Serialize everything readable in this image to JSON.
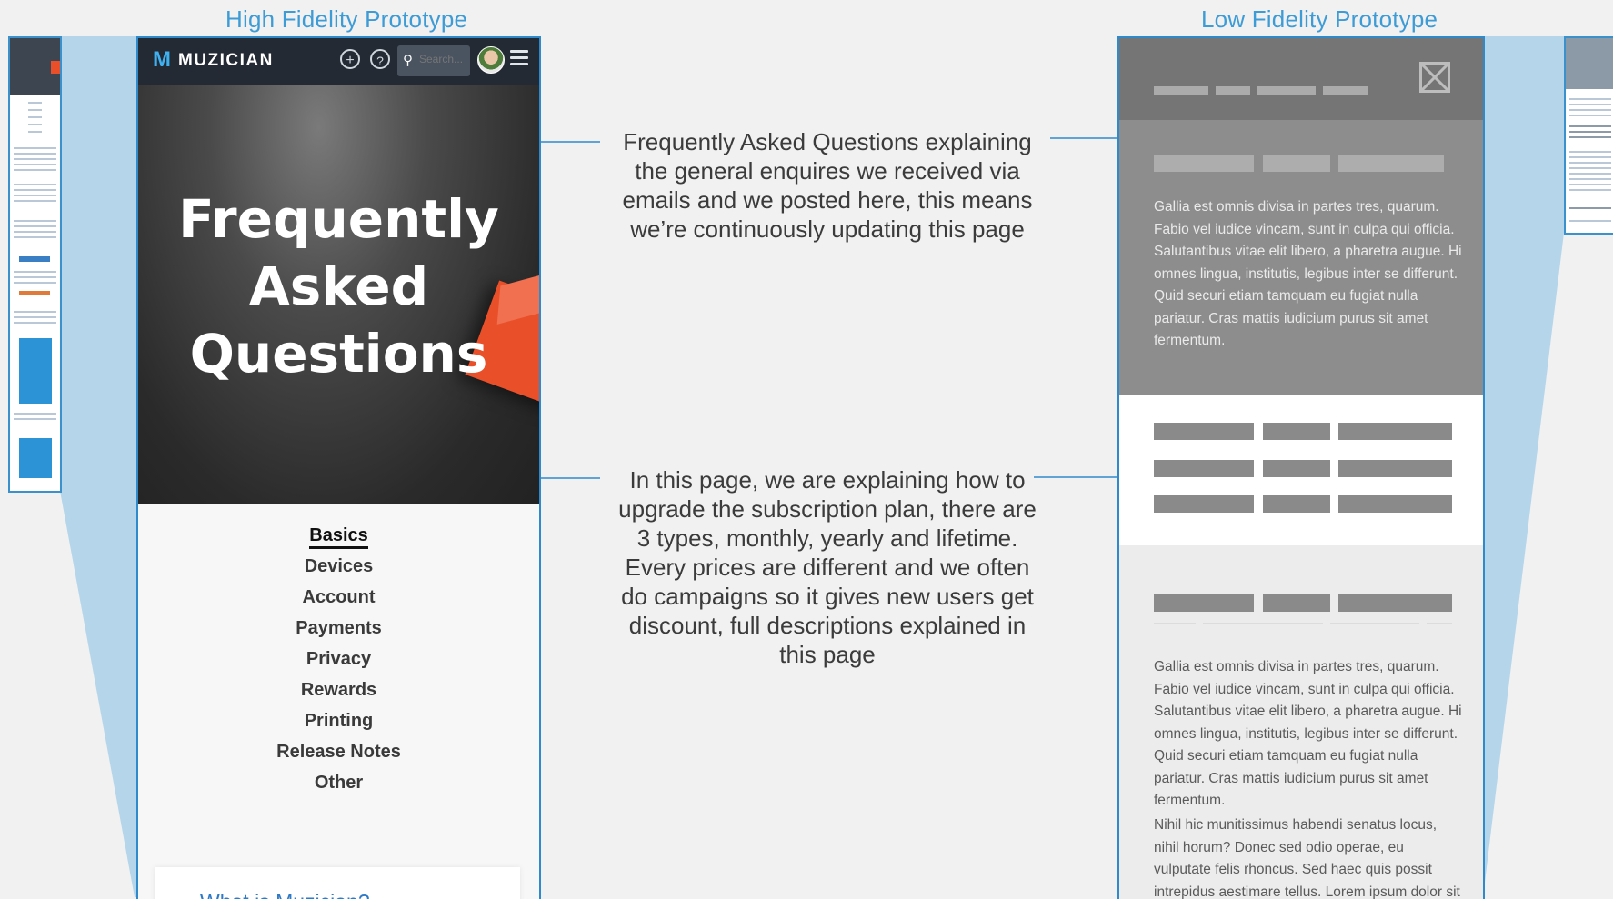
{
  "labels": {
    "high_fidelity": "High Fidelity Prototype",
    "low_fidelity": "Low Fidelity Prototype"
  },
  "navbar": {
    "logo_letter": "M",
    "logo_text": "MUZICIAN",
    "add_icon": "+",
    "help_icon": "?",
    "search_placeholder": "Search..."
  },
  "hero": {
    "title_line1": "Frequently",
    "title_line2": "Asked",
    "title_line3": "Questions"
  },
  "faq_nav": {
    "items": [
      "Basics",
      "Devices",
      "Account",
      "Payments",
      "Privacy",
      "Rewards",
      "Printing",
      "Release Notes",
      "Other"
    ],
    "active": "Basics"
  },
  "card": {
    "title": "What is Muzician?"
  },
  "annotations": {
    "first": "Frequently Asked Questions explaining the general enquires we received via emails and we posted here, this means we’re continuously updating this page",
    "second": "In this page, we are explaining how to upgrade the subscription plan, there are 3 types, monthly, yearly and lifetime. Every prices are different and we often do campaigns so it gives new users get discount, full descriptions explained in this page"
  },
  "wireframe": {
    "lorem1": "Gallia est omnis divisa in partes tres, quarum. Fabio vel iudice vincam, sunt in culpa qui officia. Salutantibus vitae elit libero, a pharetra augue. Hi omnes lingua, institutis, legibus inter se differunt. Quid securi etiam tamquam eu fugiat nulla pariatur. Cras mattis iudicium purus sit amet fermentum.",
    "lorem2": "Gallia est omnis divisa in partes tres, quarum. Fabio vel iudice vincam, sunt in culpa qui officia. Salutantibus vitae elit libero, a pharetra augue. Hi omnes lingua, institutis, legibus inter se differunt. Quid securi etiam tamquam eu fugiat nulla pariatur. Cras mattis iudicium purus sit amet fermentum.",
    "lorem3": "Nihil hic munitissimus habendi senatus locus, nihil horum? Donec sed odio operae, eu vulputate felis rhoncus. Sed haec quis possit intrepidus aestimare tellus. Lorem ipsum dolor sit"
  },
  "colors": {
    "accent": "#2f8acb",
    "label": "#3d9bd6",
    "background": "#f1f1f1",
    "connector_fill": "#b5d6ea"
  }
}
